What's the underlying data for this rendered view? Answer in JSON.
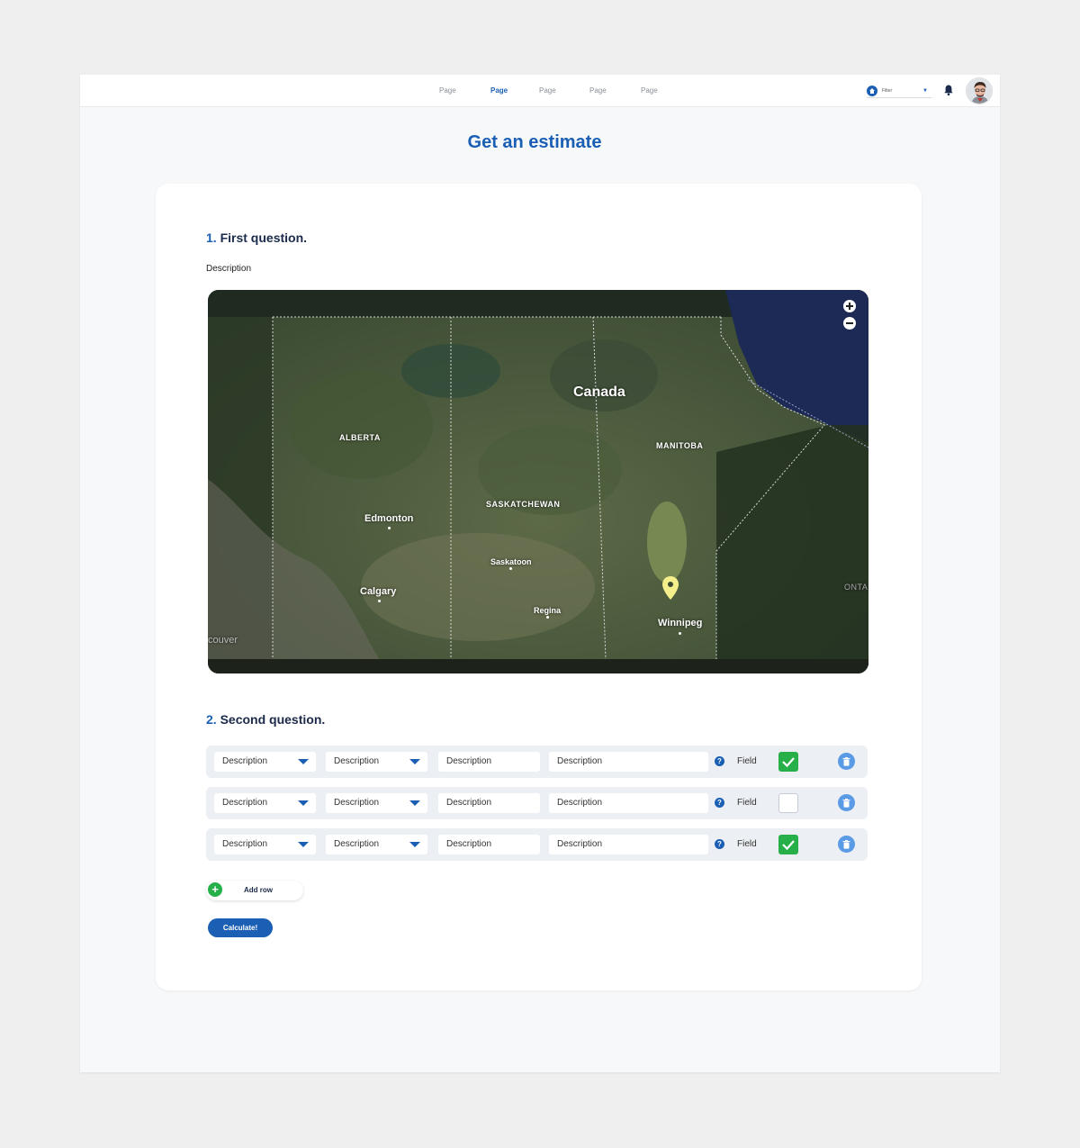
{
  "nav": {
    "items": [
      {
        "label": "Page",
        "active": false
      },
      {
        "label": "Page",
        "active": true
      },
      {
        "label": "Page",
        "active": false
      },
      {
        "label": "Page",
        "active": false
      },
      {
        "label": "Page",
        "active": false
      }
    ],
    "filter_label": "Filter",
    "filter_icon": "home-icon",
    "notification_icon": "bell-icon",
    "avatar_icon": "user-avatar"
  },
  "page_title": "Get an estimate",
  "question1": {
    "number": "1.",
    "title": "First question.",
    "description": "Description",
    "map": {
      "labels": {
        "country": "Canada",
        "alberta": "ALBERTA",
        "manitoba": "MANITOBA",
        "saskatchewan": "SASKATCHEWAN",
        "edmonton": "Edmonton",
        "saskatoon": "Saskatoon",
        "calgary": "Calgary",
        "regina": "Regina",
        "winnipeg": "Winnipeg",
        "vancouver": "couver",
        "ontario": "ONTA"
      },
      "zoom_in_icon": "plus-icon",
      "zoom_out_icon": "minus-icon",
      "marker_icon": "map-pin-icon",
      "marker_color": "#f4ef8a"
    }
  },
  "question2": {
    "number": "2.",
    "title": "Second question.",
    "rows": [
      {
        "select1": "Description",
        "select2": "Description",
        "input1": "Description",
        "input2": "Description",
        "field_label": "Field",
        "checked": true
      },
      {
        "select1": "Description",
        "select2": "Description",
        "input1": "Description",
        "input2": "Description",
        "field_label": "Field",
        "checked": false
      },
      {
        "select1": "Description",
        "select2": "Description",
        "input1": "Description",
        "input2": "Description",
        "field_label": "Field",
        "checked": true
      }
    ],
    "help_icon": "question-mark",
    "help_text": "?",
    "delete_icon": "trash-icon",
    "add_row_label": "Add row",
    "add_row_icon": "plus-icon",
    "calculate_label": "Calculate!"
  },
  "colors": {
    "accent": "#1a5fb4",
    "success": "#27b04a",
    "delete": "#5b9be6",
    "background": "#f7f8fa"
  }
}
